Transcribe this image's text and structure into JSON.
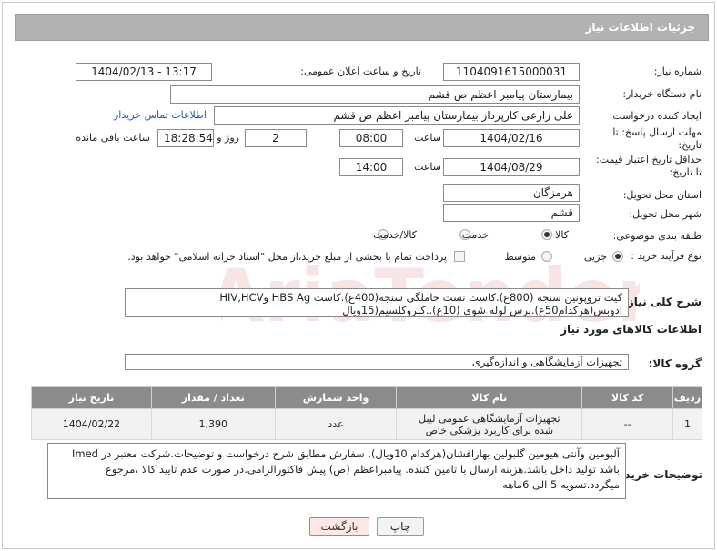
{
  "header": {
    "title": "جزئیات اطلاعات نیاز"
  },
  "labels": {
    "need_number": "شماره نیاز:",
    "announce_datetime": "تاریخ و ساعت اعلان عمومی:",
    "buyer_org": "نام دستگاه خریدار:",
    "creator": "ایجاد کننده درخواست:",
    "reply_deadline_line1": "مهلت ارسال پاسخ: تا",
    "reply_deadline_line2": "تاریخ:",
    "price_validity_line1": "حداقل تاریخ اعتبار قیمت:",
    "price_validity_line2": "تا تاریخ:",
    "time": "ساعت",
    "days_and": "روز و",
    "remaining": "ساعت باقی مانده",
    "province": "استان محل تحویل:",
    "city": "شهر محل تحویل:",
    "category": "طبقه بندی موضوعی:",
    "process": "نوع فرآیند خرید :",
    "description": "شرح کلی نیاز:",
    "goods_info": "اطلاعات کالاهای مورد نیاز",
    "goods_group": "گروه کالا:",
    "buyer_notes": "توضیحات خریدار:"
  },
  "values": {
    "need_number": "1104091615000031",
    "announce_datetime": "1404/02/13 - 13:17",
    "buyer_org": "بیمارستان پیامبر اعظم  ص  قشم",
    "creator": "علی زارعی کارپرداز بیمارستان پیامبر اعظم  ص  قشم",
    "contact_link": "اطلاعات تماس خریدار",
    "reply_date": "1404/02/16",
    "reply_time": "08:00",
    "days": "2",
    "remaining_time": "18:28:54",
    "validity_date": "1404/08/29",
    "validity_time": "14:00",
    "province": "هرمزگان",
    "city": "قشم",
    "goods_group": "تجهیزات آزمایشگاهی و اندازه‌گیری"
  },
  "category_options": [
    {
      "label": "کالا",
      "selected": true
    },
    {
      "label": "خدمت",
      "selected": false
    },
    {
      "label": "کالا/خدمت",
      "selected": false
    }
  ],
  "process_options": [
    {
      "label": "جزیی",
      "selected": true
    },
    {
      "label": "متوسط",
      "selected": false
    }
  ],
  "payment_note": "پرداخت تمام یا بخشی از مبلغ خرید،از محل \"اسناد خزانه اسلامی\" خواهد بود.",
  "description_lines": [
    "کیت تروپونین سنجه (800ع).کاست تست حاملگی سنجه(400ع).کاست HBS Ag وHIV,HCV",
    "ادوبس(هرکدام50ع).برس لوله شوی (10ع)..کلروکلسیم(15ویال"
  ],
  "table": {
    "headers": [
      "ردیف",
      "کد کالا",
      "نام کالا",
      "واحد شمارش",
      "تعداد / مقدار",
      "تاریخ نیاز"
    ],
    "rows": [
      [
        "1",
        "--",
        "تجهیزات آزمایشگاهی عمومی لیبل شده برای کاربرد پزشکی خاص",
        "عدد",
        "1,390",
        "1404/02/22"
      ]
    ]
  },
  "buyer_notes_lines": [
    "آلبومین وآنتی هیومین گلبولین بهارافشان(هرکدام 10ویال). سفارش مطابق شرح درخواست و توضیحات.شرکت معتبر در Imed",
    "باشد تولید داخل باشد.هزینه ارسال با تامین کننده. پیامبراعظم (ص) پیش فاکتورالزامی.در صورت عدم تایید  کالا ،مرجوع",
    "میگردد.تسویه 5 الی 6ماهه"
  ],
  "buttons": {
    "print": "چاپ",
    "back": "بازگشت"
  },
  "colors": {
    "header_bg": "#b2b2b2",
    "table_header_bg": "#8b8b8b",
    "link": "#1a5fb4",
    "back_button": "#fde8e8"
  }
}
